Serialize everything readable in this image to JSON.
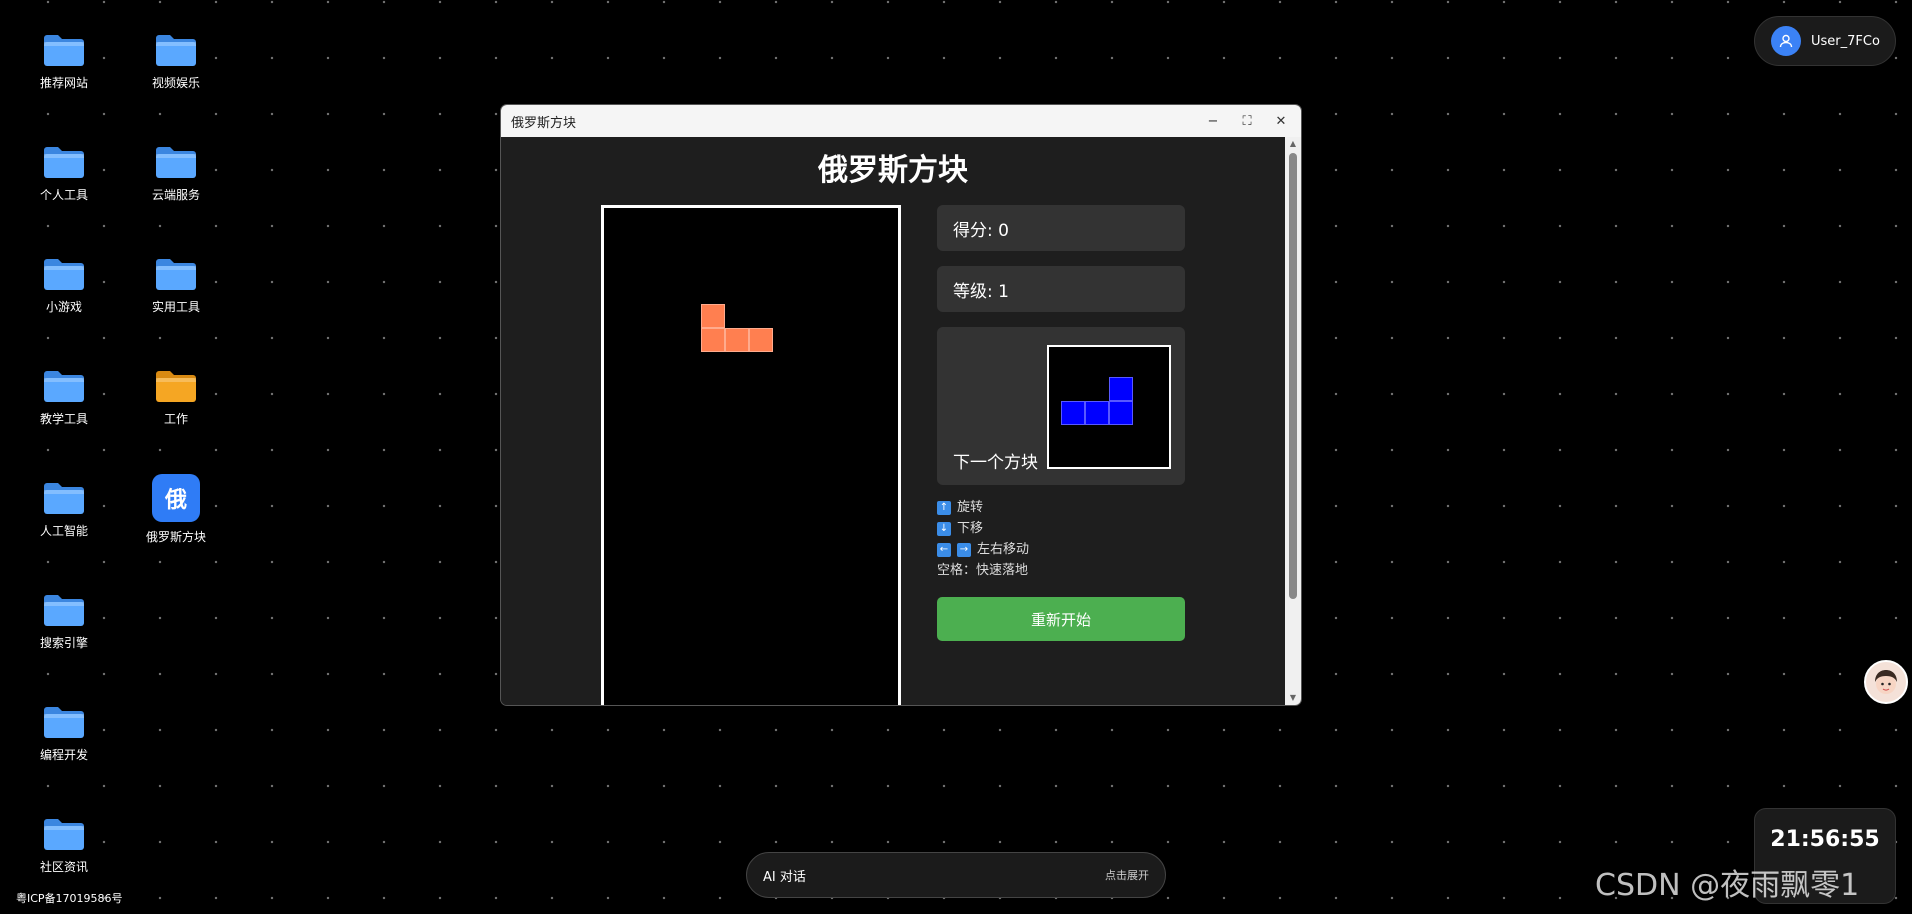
{
  "desktop": {
    "icons": [
      {
        "label": "推荐网站",
        "kind": "folder"
      },
      {
        "label": "视频娱乐",
        "kind": "folder"
      },
      {
        "label": "个人工具",
        "kind": "folder"
      },
      {
        "label": "云端服务",
        "kind": "folder"
      },
      {
        "label": "小游戏",
        "kind": "folder"
      },
      {
        "label": "实用工具",
        "kind": "folder"
      },
      {
        "label": "教学工具",
        "kind": "folder"
      },
      {
        "label": "工作",
        "kind": "folder-orange"
      },
      {
        "label": "人工智能",
        "kind": "folder"
      },
      {
        "label": "俄罗斯方块",
        "kind": "app",
        "glyph": "俄"
      },
      {
        "label": "搜索引擎",
        "kind": "folder"
      },
      {
        "label": "编程开发",
        "kind": "folder"
      },
      {
        "label": "社区资讯",
        "kind": "folder"
      }
    ]
  },
  "user": {
    "name": "User_7FCo"
  },
  "window": {
    "title": "俄罗斯方块",
    "controls": {
      "minimize": "−",
      "maximize": "⛶",
      "close": "✕"
    }
  },
  "game": {
    "title": "俄罗斯方块",
    "score_label": "得分: 0",
    "level_label": "等级: 1",
    "next_label": "下一个方块",
    "help": {
      "rotate": "旋转",
      "down": "下移",
      "move": "左右移动",
      "drop": "空格：快速落地"
    },
    "restart_label": "重新开始",
    "current_piece": {
      "color": "#ff7f50",
      "cells": [
        [
          0,
          0
        ],
        [
          0,
          1
        ],
        [
          1,
          1
        ],
        [
          2,
          1
        ]
      ]
    },
    "next_piece": {
      "color": "#0000ff",
      "cells": [
        [
          2,
          0
        ],
        [
          0,
          1
        ],
        [
          1,
          1
        ],
        [
          2,
          1
        ]
      ]
    }
  },
  "ai_bar": {
    "label": "AI 对话",
    "expand": "点击展开"
  },
  "clock": {
    "time": "21:56:55"
  },
  "footer": {
    "icp": "粤ICP备17019586号"
  },
  "watermark": "CSDN @夜雨飘零1"
}
